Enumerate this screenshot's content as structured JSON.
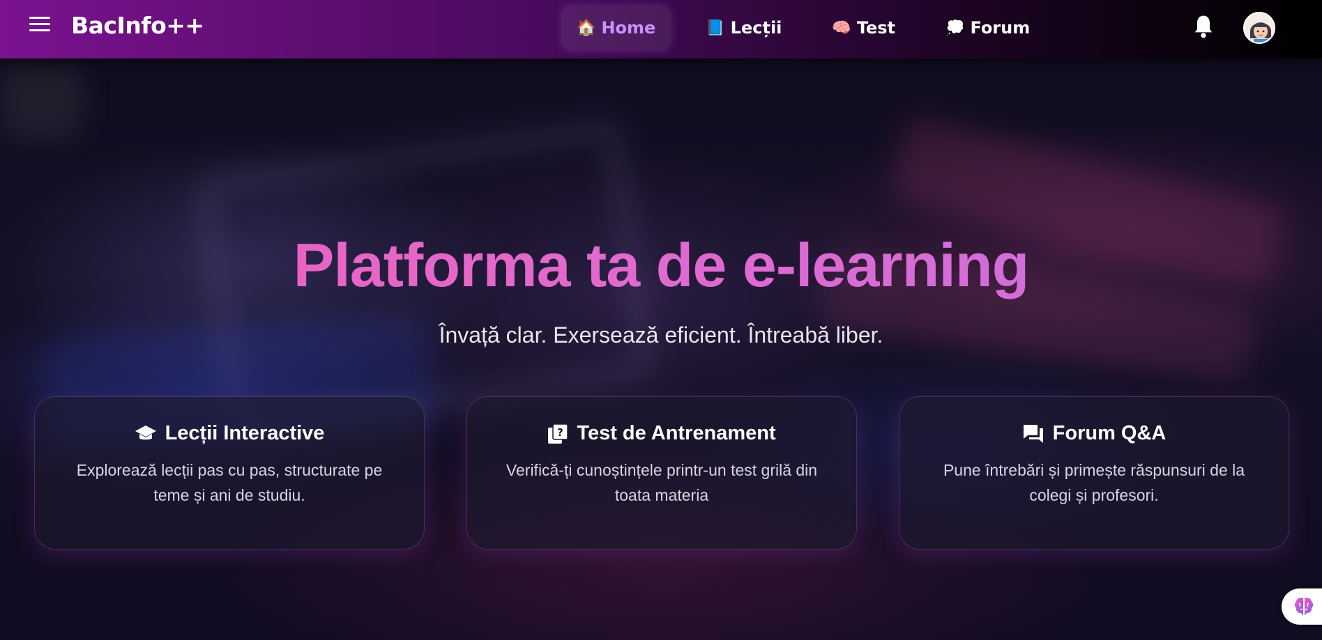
{
  "header": {
    "logo": "BacInfo++",
    "nav": [
      {
        "icon": "🏠",
        "label": "Home",
        "active": true
      },
      {
        "icon": "📘",
        "label": "Lecții",
        "active": false
      },
      {
        "icon": "🧠",
        "label": "Test",
        "active": false
      },
      {
        "icon": "💭",
        "label": "Forum",
        "active": false
      }
    ],
    "icons": [
      "menu-icon",
      "bell-icon",
      "avatar"
    ]
  },
  "hero": {
    "title": "Platforma ta de e-learning",
    "subtitle": "Învață clar. Exersează eficient. Întreabă liber."
  },
  "cards": [
    {
      "icon": "graduation-cap-icon",
      "title": "Lecții Interactive",
      "text": "Explorează lecții pas cu pas, structurate pe teme și ani de studiu."
    },
    {
      "icon": "quiz-icon",
      "title": "Test de Antrenament",
      "text": "Verifică-ți cunoștințele printr-un test grilă din toata materia"
    },
    {
      "icon": "forum-icon",
      "title": "Forum Q&A",
      "text": "Pune întrebări și primește răspunsuri de la colegi și profesori."
    }
  ],
  "colors": {
    "header_start": "#7b128f",
    "header_end": "#000000",
    "nav_active": "#c593ff",
    "title_gradient_start": "#ef5fb8",
    "title_gradient_end": "#c86fe0"
  },
  "floating": {
    "icon": "brain-icon"
  }
}
